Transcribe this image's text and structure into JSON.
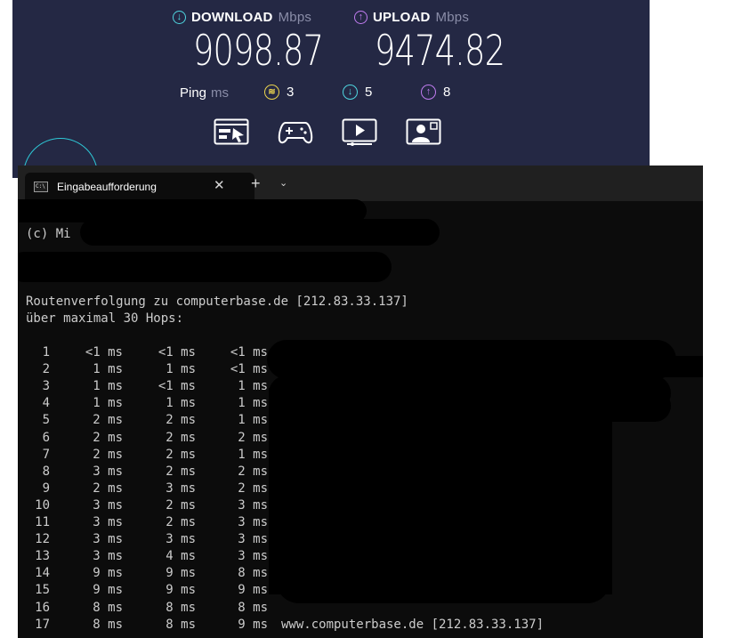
{
  "speedtest": {
    "download": {
      "label": "DOWNLOAD",
      "unit": "Mbps",
      "value": "9098.87"
    },
    "upload": {
      "label": "UPLOAD",
      "unit": "Mbps",
      "value": "9474.82"
    },
    "ping": {
      "label": "Ping",
      "unit": "ms",
      "idle": "3",
      "download": "5",
      "upload": "8"
    },
    "apps": [
      {
        "icon": "browsing-icon",
        "rating": "●●●●●"
      },
      {
        "icon": "gamepad-icon",
        "rating": "●●●●●"
      },
      {
        "icon": "video-streaming-icon",
        "rating": "●●●●●"
      },
      {
        "icon": "video-call-icon",
        "rating": "●●●●●"
      }
    ]
  },
  "terminal": {
    "tab_title": "Eingabeaufforderung",
    "new_tab_glyph": "+",
    "close_glyph": "✕",
    "dropdown_glyph": "⌄",
    "copyright_fragment": "(c) Mi",
    "trace_header": "Routenverfolgung zu computerbase.de [212.83.33.137]",
    "trace_subheader": "über maximal 30 Hops:",
    "hops": [
      {
        "n": "1",
        "t1": "<1 ms",
        "t2": "<1 ms",
        "t3": "<1 ms",
        "host": ""
      },
      {
        "n": "2",
        "t1": "1 ms",
        "t2": "1 ms",
        "t3": "<1 ms",
        "host": ""
      },
      {
        "n": "3",
        "t1": "1 ms",
        "t2": "<1 ms",
        "t3": "1 ms",
        "host": ""
      },
      {
        "n": "4",
        "t1": "1 ms",
        "t2": "1 ms",
        "t3": "1 ms",
        "host": ""
      },
      {
        "n": "5",
        "t1": "2 ms",
        "t2": "2 ms",
        "t3": "1 ms",
        "host": ""
      },
      {
        "n": "6",
        "t1": "2 ms",
        "t2": "2 ms",
        "t3": "2 ms",
        "host": ""
      },
      {
        "n": "7",
        "t1": "2 ms",
        "t2": "2 ms",
        "t3": "1 ms",
        "host": ""
      },
      {
        "n": "8",
        "t1": "3 ms",
        "t2": "2 ms",
        "t3": "2 ms",
        "host": ""
      },
      {
        "n": "9",
        "t1": "2 ms",
        "t2": "3 ms",
        "t3": "2 ms",
        "host": ""
      },
      {
        "n": "10",
        "t1": "3 ms",
        "t2": "2 ms",
        "t3": "3 ms",
        "host": ""
      },
      {
        "n": "11",
        "t1": "3 ms",
        "t2": "2 ms",
        "t3": "3 ms",
        "host": ""
      },
      {
        "n": "12",
        "t1": "3 ms",
        "t2": "3 ms",
        "t3": "3 ms",
        "host": ""
      },
      {
        "n": "13",
        "t1": "3 ms",
        "t2": "4 ms",
        "t3": "3 ms",
        "host": ""
      },
      {
        "n": "14",
        "t1": "9 ms",
        "t2": "9 ms",
        "t3": "8 ms",
        "host": ""
      },
      {
        "n": "15",
        "t1": "9 ms",
        "t2": "9 ms",
        "t3": "9 ms",
        "host": ""
      },
      {
        "n": "16",
        "t1": "8 ms",
        "t2": "8 ms",
        "t3": "8 ms",
        "host": ""
      },
      {
        "n": "17",
        "t1": "8 ms",
        "t2": "8 ms",
        "t3": "9 ms",
        "host": "www.computerbase.de [212.83.33.137]"
      }
    ]
  }
}
